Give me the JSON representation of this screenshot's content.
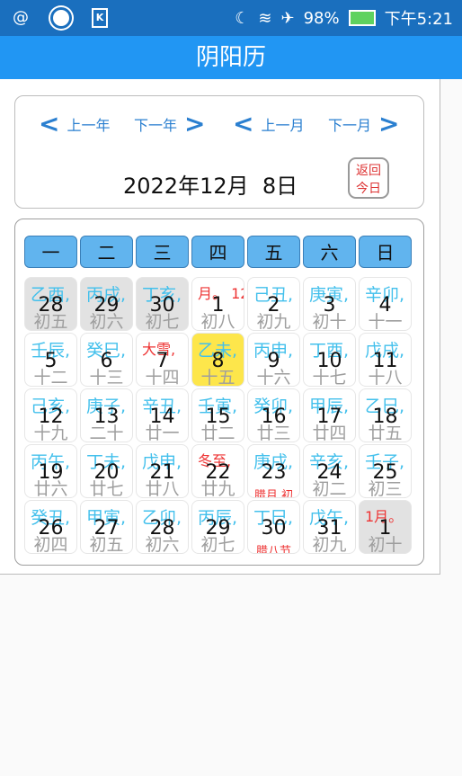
{
  "statusbar": {
    "battery": "98%",
    "time": "下午5:21"
  },
  "appbar": {
    "title": "阴阳历"
  },
  "nav": {
    "prev_year": "上一年",
    "next_year": "下一年",
    "prev_month": "上一月",
    "next_month": "下一月",
    "current": "2022年12月  8日",
    "today_l1": "返回",
    "today_l2": "今日"
  },
  "weekdays": [
    "一",
    "二",
    "三",
    "四",
    "五",
    "六",
    "日"
  ],
  "days": [
    {
      "gz": "乙酉,",
      "num": "28",
      "lunar": "初五",
      "extra": "",
      "other": true
    },
    {
      "gz": "丙戌,",
      "num": "29",
      "lunar": "初六",
      "extra": "",
      "other": true
    },
    {
      "gz": "丁亥,",
      "num": "30",
      "lunar": "初七",
      "extra": "",
      "other": true
    },
    {
      "gz": "月。     12",
      "num": "1",
      "lunar": "初八",
      "extra": "",
      "red": true
    },
    {
      "gz": "己丑,",
      "num": "2",
      "lunar": "初九",
      "extra": ""
    },
    {
      "gz": "庚寅,",
      "num": "3",
      "lunar": "初十",
      "extra": ""
    },
    {
      "gz": "辛卯,",
      "num": "4",
      "lunar": "十一",
      "extra": ""
    },
    {
      "gz": "壬辰,",
      "num": "5",
      "lunar": "十二",
      "extra": ""
    },
    {
      "gz": "癸巳,",
      "num": "6",
      "lunar": "十三",
      "extra": ""
    },
    {
      "gz": "大雪,",
      "num": "7",
      "lunar": "十四",
      "extra": "",
      "red": true
    },
    {
      "gz": "乙未,",
      "num": "8",
      "lunar": "十五",
      "extra": "",
      "today": true
    },
    {
      "gz": "丙申,",
      "num": "9",
      "lunar": "十六",
      "extra": ""
    },
    {
      "gz": "丁酉,",
      "num": "10",
      "lunar": "十七",
      "extra": ""
    },
    {
      "gz": "戊戌,",
      "num": "11",
      "lunar": "十八",
      "extra": ""
    },
    {
      "gz": "己亥,",
      "num": "12",
      "lunar": "十九",
      "extra": ""
    },
    {
      "gz": "庚子,",
      "num": "13",
      "lunar": "二十",
      "extra": ""
    },
    {
      "gz": "辛丑,",
      "num": "14",
      "lunar": "廿一",
      "extra": ""
    },
    {
      "gz": "壬寅,",
      "num": "15",
      "lunar": "廿二",
      "extra": ""
    },
    {
      "gz": "癸卯,",
      "num": "16",
      "lunar": "廿三",
      "extra": ""
    },
    {
      "gz": "甲辰,",
      "num": "17",
      "lunar": "廿四",
      "extra": ""
    },
    {
      "gz": "乙巳,",
      "num": "18",
      "lunar": "廿五",
      "extra": ""
    },
    {
      "gz": "丙午,",
      "num": "19",
      "lunar": "廿六",
      "extra": ""
    },
    {
      "gz": "丁未,",
      "num": "20",
      "lunar": "廿七",
      "extra": ""
    },
    {
      "gz": "戊申,",
      "num": "21",
      "lunar": "廿八",
      "extra": ""
    },
    {
      "gz": "冬至,",
      "num": "22",
      "lunar": "廿九",
      "extra": "",
      "red": true
    },
    {
      "gz": "庚戌,",
      "num": "23",
      "lunar": "",
      "extra": "腊月,初"
    },
    {
      "gz": "辛亥,",
      "num": "24",
      "lunar": "初二",
      "extra": ""
    },
    {
      "gz": "壬子,",
      "num": "25",
      "lunar": "初三",
      "extra": ""
    },
    {
      "gz": "癸丑,",
      "num": "26",
      "lunar": "初四",
      "extra": ""
    },
    {
      "gz": "甲寅,",
      "num": "27",
      "lunar": "初五",
      "extra": ""
    },
    {
      "gz": "乙卯,",
      "num": "28",
      "lunar": "初六",
      "extra": ""
    },
    {
      "gz": "丙辰,",
      "num": "29",
      "lunar": "初七",
      "extra": ""
    },
    {
      "gz": "丁巳,",
      "num": "30",
      "lunar": "",
      "extra": "腊八节"
    },
    {
      "gz": "戊午,",
      "num": "31",
      "lunar": "初九",
      "extra": ""
    },
    {
      "gz": "1月。",
      "num": "1",
      "lunar": "初十",
      "extra": "",
      "red": true,
      "other": true
    }
  ]
}
